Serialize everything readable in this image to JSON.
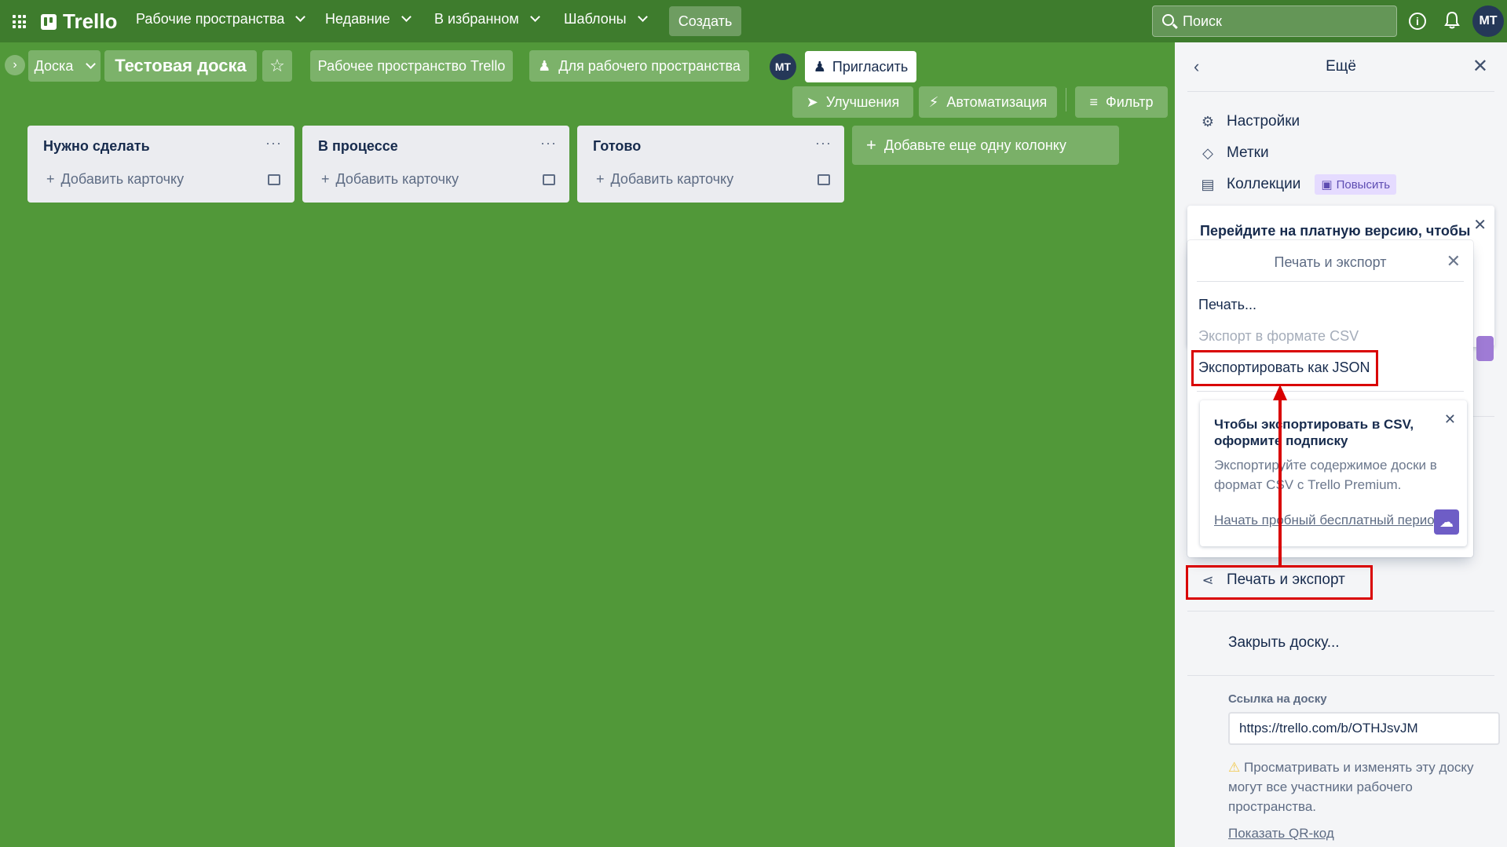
{
  "nav": {
    "brand": "Trello",
    "workspaces": "Рабочие пространства",
    "recent": "Недавние",
    "starred": "В избранном",
    "templates": "Шаблоны",
    "create": "Создать",
    "search_placeholder": "Поиск",
    "avatar_initials": "MT"
  },
  "board_header": {
    "view": "Доска",
    "title": "Тестовая доска",
    "workspace": "Рабочее пространство Trello",
    "visibility": "Для рабочего пространства",
    "member_initials": "MT",
    "invite": "Пригласить",
    "powerups": "Улучшения",
    "automation": "Автоматизация",
    "filter": "Фильтр"
  },
  "lists": [
    {
      "title": "Нужно сделать",
      "add_card": "Добавить карточку"
    },
    {
      "title": "В процессе",
      "add_card": "Добавить карточку"
    },
    {
      "title": "Готово",
      "add_card": "Добавить карточку"
    }
  ],
  "add_list": "Добавьте еще одну колонку",
  "panel": {
    "title": "Ещё",
    "settings": "Настройки",
    "labels": "Метки",
    "collections": "Коллекции",
    "upgrade_badge": "Повысить",
    "upgrade_text": "Перейдите на платную версию, чтобы",
    "print_export": "Печать и экспорт",
    "close_board": "Закрыть доску...",
    "link_label": "Ссылка на доску",
    "link_value": "https://trello.com/b/OTHJsvJM",
    "link_note": "Просматривать и изменять эту доску могут все участники рабочего пространства.",
    "qr_link": "Показать QR-код"
  },
  "popover": {
    "title": "Печать и экспорт",
    "print": "Печать...",
    "export_csv": "Экспорт в формате CSV",
    "export_json": "Экспортировать как JSON",
    "csv_card": {
      "title": "Чтобы экспортировать в CSV, оформите подписку",
      "text": "Экспортируйте содержимое доски в формат CSV с Trello Premium.",
      "link": "Начать пробный бесплатный период"
    }
  },
  "colors": {
    "board_bg": "#519839",
    "nav_bg": "#3e7c2d",
    "annotation": "#d90000"
  }
}
